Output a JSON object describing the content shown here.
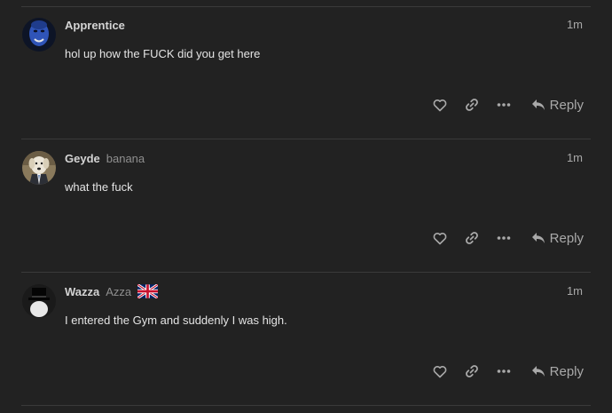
{
  "posts": [
    {
      "username": "Apprentice",
      "fullname": "",
      "time": "1m",
      "body": "hol up how the FUCK did you get here",
      "avatar_icon": "blue-face-avatar",
      "reply_label": "Reply"
    },
    {
      "username": "Geyde",
      "fullname": "banana",
      "time": "1m",
      "body": "what the fuck",
      "avatar_icon": "dog-in-suit-avatar",
      "reply_label": "Reply"
    },
    {
      "username": "Wazza",
      "fullname": "Azza",
      "flag_icon": "union-jack-flag-icon",
      "time": "1m",
      "body": "I entered the Gym and suddenly I was high.",
      "avatar_icon": "top-hat-avatar",
      "reply_label": "Reply"
    }
  ],
  "colors": {
    "background": "#222222",
    "divider": "#3a3a3a",
    "username": "#d4d4d4",
    "fullname": "#8f8f8f",
    "icon": "#a9a9a9"
  }
}
